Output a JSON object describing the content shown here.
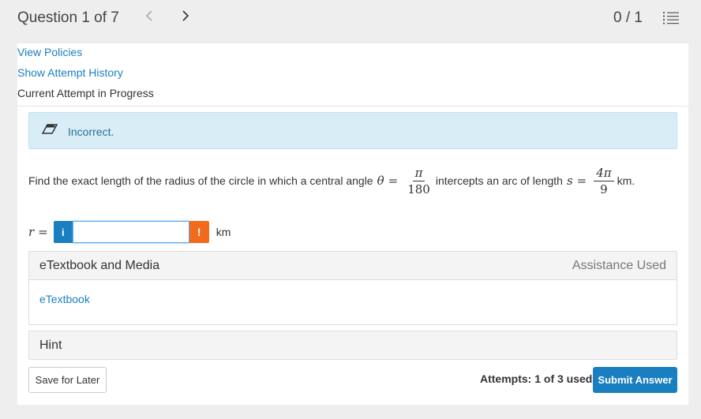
{
  "header": {
    "question_title": "Question 1 of 7",
    "prev_icon": "chevron-left-icon",
    "next_icon": "chevron-right-icon",
    "score": "0 / 1",
    "list_icon": "question-list-icon"
  },
  "links": {
    "view_policies": "View Policies",
    "attempt_history": "Show Attempt History"
  },
  "attempt_status": "Current Attempt in Progress",
  "alert": {
    "icon": "eraser-icon",
    "text": "Incorrect.",
    "color": "#d9edf7"
  },
  "question": {
    "text_before": "Find the exact length of the radius of the circle in which a central angle",
    "theta": "θ",
    "equals": "=",
    "angle_num": "π",
    "angle_den": "180",
    "text_middle": "intercepts an arc of length",
    "s_var": "s",
    "arc_num": "4π",
    "arc_den": "9",
    "text_after": "km."
  },
  "answer": {
    "variable": "r",
    "equals": "=",
    "info_label": "i",
    "value": "",
    "placeholder": "",
    "warning_label": "!",
    "unit": "km"
  },
  "media_section": {
    "title": "eTextbook and Media",
    "status": "Assistance Used",
    "link": "eTextbook"
  },
  "hint_section": {
    "title": "Hint"
  },
  "footer": {
    "save_label": "Save for Later",
    "attempts": "Attempts: 1 of 3 used",
    "submit_label": "Submit Answer"
  },
  "colors": {
    "accent": "#1a7fc1",
    "warning": "#f26b1d"
  }
}
